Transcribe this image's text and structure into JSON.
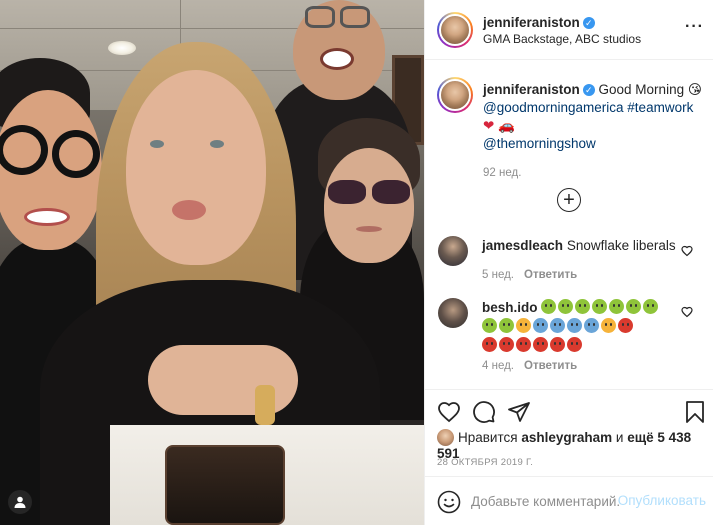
{
  "post": {
    "author": "jenniferaniston",
    "location": "GMA Backstage, ABC studios",
    "more_icon": "more-horizontal-icon",
    "caption": {
      "author": "jenniferaniston",
      "text_1": "Good Morning",
      "emoji_1": "😘",
      "mention_1": "@goodmorningamerica",
      "hashtag_1": "#teamwork",
      "emoji_2": "❤",
      "emoji_3": "🚗",
      "mention_2": "@themorningshow",
      "age": "92 нед."
    },
    "load_more_icon": "plus-circle-icon"
  },
  "comments": [
    {
      "author": "jamesdleach",
      "text": "Snowflake liberals",
      "age": "5 нед.",
      "reply_label": "Ответить"
    },
    {
      "author": "besh.ido",
      "emoji_rows": [
        [
          "green",
          "green",
          "green",
          "green",
          "green",
          "green",
          "green"
        ],
        [
          "green",
          "green",
          "orange",
          "blue",
          "blue",
          "blue",
          "blue",
          "orange",
          "red"
        ],
        [
          "red",
          "red",
          "red",
          "red",
          "red",
          "red"
        ]
      ],
      "age": "4 нед.",
      "reply_label": "Ответить"
    }
  ],
  "actions": {
    "like_icon": "heart-icon",
    "comment_icon": "comment-icon",
    "share_icon": "share-icon",
    "save_icon": "bookmark-icon"
  },
  "likes": {
    "prefix": "Нравится",
    "user": "ashleygraham",
    "joiner": "и",
    "rest": "ещё 5 438 591"
  },
  "date": "28 ОКТЯБРЯ 2019 Г.",
  "add_comment": {
    "emoji_icon": "smile-icon",
    "placeholder": "Добавьте комментарий...",
    "publish_label": "Опубликовать"
  },
  "photo": {
    "user_tag_icon": "user-tag-icon"
  },
  "colors": {
    "link": "#00376b",
    "verified": "#3897f0",
    "publish_disabled": "#b2dffc",
    "muted": "#8e8e8e",
    "like_red": "#ed4956"
  }
}
